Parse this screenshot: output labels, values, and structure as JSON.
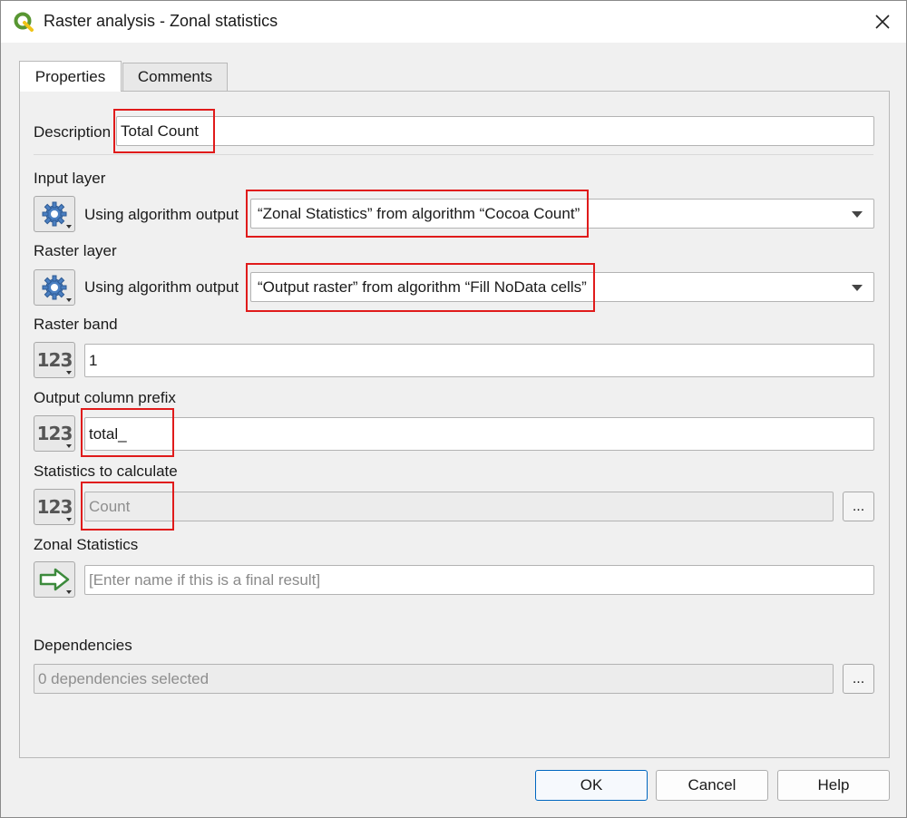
{
  "window": {
    "title": "Raster analysis - Zonal statistics"
  },
  "tabs": [
    {
      "label": "Properties",
      "active": true
    },
    {
      "label": "Comments",
      "active": false
    }
  ],
  "description": {
    "label": "Description",
    "value": "Total Count"
  },
  "input_layer": {
    "label": "Input layer",
    "source_label": "Using algorithm output",
    "value": "“Zonal Statistics” from algorithm “Cocoa Count”"
  },
  "raster_layer": {
    "label": "Raster layer",
    "source_label": "Using algorithm output",
    "value": "“Output raster” from algorithm “Fill NoData cells”"
  },
  "raster_band": {
    "label": "Raster band",
    "icon": "123",
    "value": "1"
  },
  "output_prefix": {
    "label": "Output column prefix",
    "icon": "123",
    "value": "total_"
  },
  "statistics": {
    "label": "Statistics to calculate",
    "icon": "123",
    "value": "Count",
    "more": "..."
  },
  "zonal_output": {
    "label": "Zonal Statistics",
    "placeholder": "[Enter name if this is a final result]"
  },
  "dependencies": {
    "label": "Dependencies",
    "value": "0 dependencies selected",
    "more": "..."
  },
  "buttons": {
    "ok": "OK",
    "cancel": "Cancel",
    "help": "Help"
  },
  "colors": {
    "highlight": "#e01b1b",
    "qgis_green": "#589632",
    "gear_blue": "#4a7fc1",
    "arrow_green": "#3c8a3c"
  }
}
